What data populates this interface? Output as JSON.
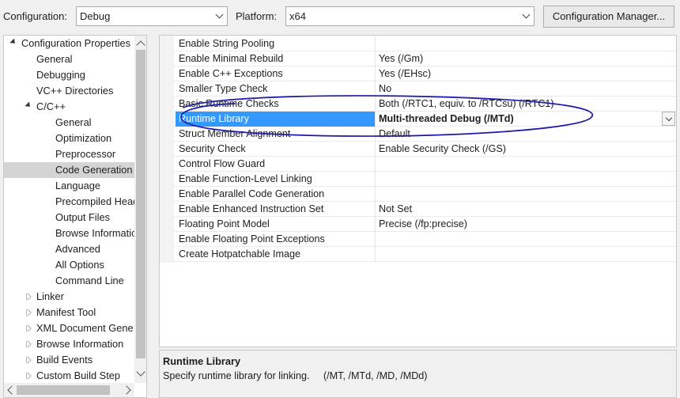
{
  "topbar": {
    "configuration_label": "Configuration:",
    "configuration_value": "Debug",
    "platform_label": "Platform:",
    "platform_value": "x64",
    "config_manager_button": "Configuration Manager..."
  },
  "tree": {
    "items": [
      {
        "label": "Configuration Properties",
        "level": 0,
        "toggle": "expanded"
      },
      {
        "label": "General",
        "level": 1,
        "toggle": "none"
      },
      {
        "label": "Debugging",
        "level": 1,
        "toggle": "none"
      },
      {
        "label": "VC++ Directories",
        "level": 1,
        "toggle": "none"
      },
      {
        "label": "C/C++",
        "level": 1,
        "toggle": "expanded"
      },
      {
        "label": "General",
        "level": 2,
        "toggle": "none"
      },
      {
        "label": "Optimization",
        "level": 2,
        "toggle": "none"
      },
      {
        "label": "Preprocessor",
        "level": 2,
        "toggle": "none"
      },
      {
        "label": "Code Generation",
        "level": 2,
        "toggle": "none",
        "selected": true
      },
      {
        "label": "Language",
        "level": 2,
        "toggle": "none"
      },
      {
        "label": "Precompiled Heade",
        "level": 2,
        "toggle": "none"
      },
      {
        "label": "Output Files",
        "level": 2,
        "toggle": "none"
      },
      {
        "label": "Browse Information",
        "level": 2,
        "toggle": "none"
      },
      {
        "label": "Advanced",
        "level": 2,
        "toggle": "none"
      },
      {
        "label": "All Options",
        "level": 2,
        "toggle": "none"
      },
      {
        "label": "Command Line",
        "level": 2,
        "toggle": "none"
      },
      {
        "label": "Linker",
        "level": 1,
        "toggle": "collapsed"
      },
      {
        "label": "Manifest Tool",
        "level": 1,
        "toggle": "collapsed"
      },
      {
        "label": "XML Document Gene",
        "level": 1,
        "toggle": "collapsed"
      },
      {
        "label": "Browse Information",
        "level": 1,
        "toggle": "collapsed"
      },
      {
        "label": "Build Events",
        "level": 1,
        "toggle": "collapsed"
      },
      {
        "label": "Custom Build Step",
        "level": 1,
        "toggle": "collapsed"
      }
    ]
  },
  "properties": [
    {
      "name": "Enable String Pooling",
      "value": ""
    },
    {
      "name": "Enable Minimal Rebuild",
      "value": "Yes (/Gm)"
    },
    {
      "name": "Enable C++ Exceptions",
      "value": "Yes (/EHsc)"
    },
    {
      "name": "Smaller Type Check",
      "value": "No"
    },
    {
      "name": "Basic Runtime Checks",
      "value": "Both (/RTC1, equiv. to /RTCsu) (/RTC1)"
    },
    {
      "name": "Runtime Library",
      "value": "Multi-threaded Debug (/MTd)",
      "selected": true
    },
    {
      "name": "Struct Member Alignment",
      "value": "Default"
    },
    {
      "name": "Security Check",
      "value": "Enable Security Check (/GS)"
    },
    {
      "name": "Control Flow Guard",
      "value": ""
    },
    {
      "name": "Enable Function-Level Linking",
      "value": ""
    },
    {
      "name": "Enable Parallel Code Generation",
      "value": ""
    },
    {
      "name": "Enable Enhanced Instruction Set",
      "value": "Not Set"
    },
    {
      "name": "Floating Point Model",
      "value": "Precise (/fp:precise)"
    },
    {
      "name": "Enable Floating Point Exceptions",
      "value": ""
    },
    {
      "name": "Create Hotpatchable Image",
      "value": ""
    }
  ],
  "description": {
    "title": "Runtime Library",
    "text": "Specify runtime library for linking.     (/MT, /MTd, /MD, /MDd)"
  },
  "colors": {
    "selection": "#3399ff",
    "annotation_ink": "#1a1aa8",
    "tree_selected": "#d4d4d4"
  }
}
